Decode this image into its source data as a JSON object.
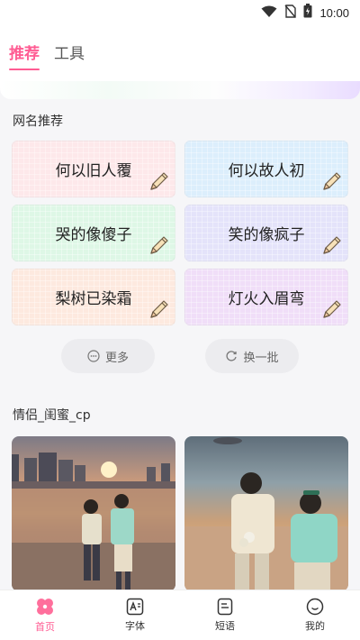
{
  "status_bar": {
    "time": "10:00",
    "icons": [
      "wifi-icon",
      "no-sim-icon",
      "battery-icon"
    ]
  },
  "top_tabs": [
    {
      "label": "推荐",
      "active": true
    },
    {
      "label": "工具",
      "active": false
    }
  ],
  "section_names": {
    "title": "网名推荐",
    "cards": [
      {
        "text": "何以旧人覆",
        "color": "#fde8ea"
      },
      {
        "text": "何以故人初",
        "color": "#dceefc"
      },
      {
        "text": "哭的像傻子",
        "color": "#def7e6"
      },
      {
        "text": "笑的像疯子",
        "color": "#e4e3fa"
      },
      {
        "text": "梨树已染霜",
        "color": "#fde9df"
      },
      {
        "text": "灯火入眉弯",
        "color": "#f0def8"
      }
    ],
    "more_label": "更多",
    "refresh_label": "换一批"
  },
  "section_photos": {
    "title": "情侣_闺蜜_cp",
    "photos": [
      "couple-photo-1",
      "couple-photo-2"
    ]
  },
  "bottom_nav": [
    {
      "label": "首页",
      "icon": "home-flower-icon",
      "active": true
    },
    {
      "label": "字体",
      "icon": "font-icon",
      "active": false
    },
    {
      "label": "短语",
      "icon": "phrase-icon",
      "active": false
    },
    {
      "label": "我的",
      "icon": "profile-icon",
      "active": false
    }
  ],
  "colors": {
    "accent": "#ff5c93"
  }
}
